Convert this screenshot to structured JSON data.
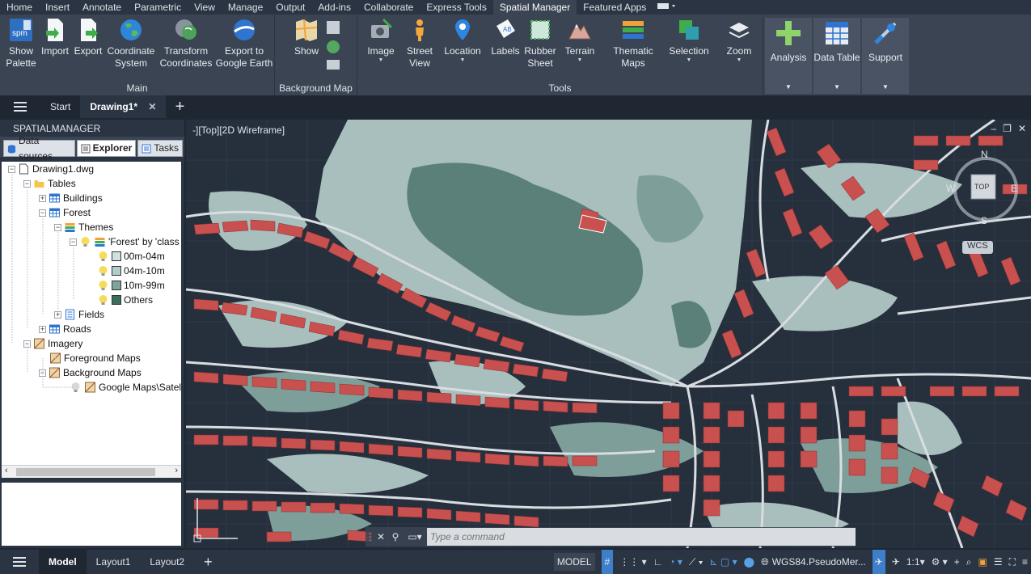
{
  "ribbon_tabs": [
    "Home",
    "Insert",
    "Annotate",
    "Parametric",
    "View",
    "Manage",
    "Output",
    "Add-ins",
    "Collaborate",
    "Express Tools",
    "Spatial Manager",
    "Featured Apps"
  ],
  "active_ribbon_tab": "Spatial Manager",
  "ribbon": {
    "main": {
      "title": "Main",
      "show_palette": "Show\nPalette",
      "import": "Import",
      "export": "Export",
      "coordinate_system": "Coordinate\nSystem",
      "transform_coordinates": "Transform\nCoordinates",
      "export_google_earth": "Export to\nGoogle Earth"
    },
    "background_map": {
      "title": "Background Map",
      "show": "Show"
    },
    "tools": {
      "title": "Tools",
      "image": "Image",
      "street_view": "Street\nView",
      "location": "Location",
      "labels": "Labels",
      "rubber_sheet": "Rubber\nSheet",
      "terrain": "Terrain",
      "thematic_maps": "Thematic\nMaps",
      "selection": "Selection",
      "zoom": "Zoom"
    },
    "analysis": "Analysis",
    "data_table": "Data Table",
    "support": "Support",
    "spm_icon_text": "spm"
  },
  "doc_tabs": {
    "start": "Start",
    "drawing": "Drawing1*"
  },
  "palette": {
    "title": "SPATIALMANAGER",
    "tabs": [
      "Data sources",
      "Explorer",
      "Tasks"
    ],
    "active_tab": "Explorer",
    "tree": {
      "root": "Drawing1.dwg",
      "tables": "Tables",
      "buildings": "Buildings",
      "forest": "Forest",
      "themes": "Themes",
      "theme_name": "'Forest' by 'class",
      "ranges": [
        "00m-04m",
        "04m-10m",
        "10m-99m",
        "Others"
      ],
      "fields": "Fields",
      "roads": "Roads",
      "imagery": "Imagery",
      "foreground_maps": "Foreground Maps",
      "background_maps": "Background Maps",
      "google_maps": "Google Maps\\Satell"
    }
  },
  "viewport": {
    "label": "-][Top][2D Wireframe]",
    "compass": {
      "n": "N",
      "w": "W",
      "e": "E",
      "s": "S",
      "top": "TOP",
      "wcs": "WCS"
    },
    "command_placeholder": "Type a command"
  },
  "status": {
    "model_tab": "Model",
    "layout1": "Layout1",
    "layout2": "Layout2",
    "model_label": "MODEL",
    "crs": "WGS84.PseudoMer...",
    "scale": "1:1"
  },
  "colors": {
    "buildings": "#c8504f",
    "forest_light": "#a8bfbd",
    "forest_mid": "#7e9e9a",
    "forest_dark": "#5b807a",
    "forest_darkest": "#3f6a5e",
    "roads": "#d9dde2",
    "background": "#26303d",
    "ribbon": "#3b4453",
    "swatch_1": "#cfe2e0",
    "swatch_2": "#b3cdca",
    "swatch_3": "#7fa39d",
    "swatch_4": "#3d6b5c"
  }
}
